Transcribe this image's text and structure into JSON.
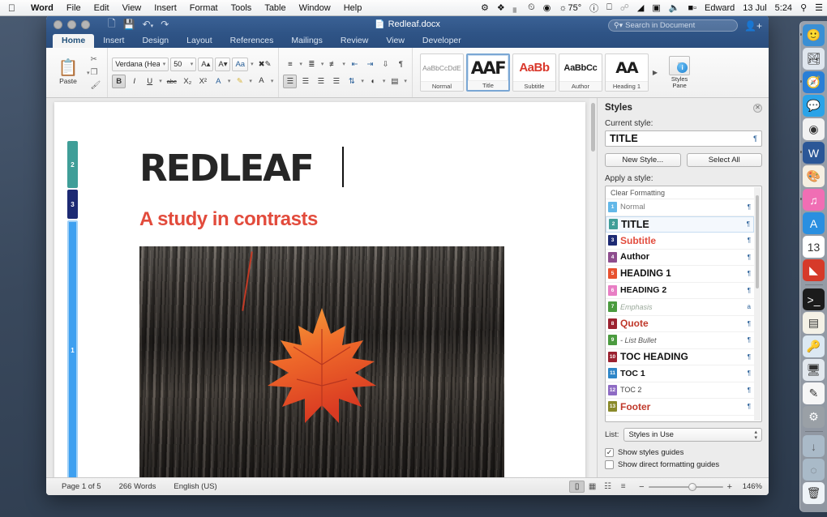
{
  "menubar": {
    "apple_icon": "apple-icon",
    "items": [
      {
        "label": "Word",
        "bold": true
      },
      {
        "label": "File",
        "bold": false
      },
      {
        "label": "Edit",
        "bold": false
      },
      {
        "label": "View",
        "bold": false
      },
      {
        "label": "Insert",
        "bold": false
      },
      {
        "label": "Format",
        "bold": false
      },
      {
        "label": "Tools",
        "bold": false
      },
      {
        "label": "Table",
        "bold": false
      },
      {
        "label": "Window",
        "bold": false
      },
      {
        "label": "Help",
        "bold": false
      }
    ],
    "status_icons": [
      "gear-icon",
      "dropbox-icon",
      "equalizer-icon",
      "clock-icon",
      "camera-icon"
    ],
    "brightness": "75°",
    "status_icons2": [
      "info-icon",
      "airplay-icon",
      "bluetooth-icon",
      "wifi-icon",
      "keyboard-icon",
      "volume-icon",
      "battery-icon"
    ],
    "user": "Edward",
    "date": "13 Jul",
    "time": "5:24",
    "search_icon": "search-icon",
    "notifications_icon": "notification-center-icon"
  },
  "titlebar": {
    "doc_icon": "word-document-icon",
    "title": "Redleaf.docx",
    "quick_access": [
      "new-document-icon",
      "save-icon",
      "undo-icon",
      "redo-icon"
    ]
  },
  "ribbon": {
    "tabs": [
      {
        "label": "Home",
        "active": true
      },
      {
        "label": "Insert",
        "active": false
      },
      {
        "label": "Design",
        "active": false
      },
      {
        "label": "Layout",
        "active": false
      },
      {
        "label": "References",
        "active": false
      },
      {
        "label": "Mailings",
        "active": false
      },
      {
        "label": "Review",
        "active": false
      },
      {
        "label": "View",
        "active": false
      },
      {
        "label": "Developer",
        "active": false
      }
    ],
    "search_placeholder": "Search in Document",
    "clipboard": {
      "paste_label": "Paste",
      "paste_icon": "clipboard-icon",
      "cut_icon": "scissors-icon",
      "copy_icon": "copy-icon",
      "format_painter_icon": "format-painter-icon"
    },
    "font": {
      "name": "Verdana (Hea....",
      "size": "50",
      "grow_label": "A",
      "shrink_label": "A",
      "change_case_label": "Aa",
      "clear_formatting_icon": "clear-formatting-icon",
      "bold_label": "B",
      "italic_label": "I",
      "underline_label": "U",
      "strikethrough_label": "abc",
      "subscript_label": "X₂",
      "superscript_label": "X²",
      "text_effects_label": "A",
      "highlight_label": "ab",
      "font_color_label": "A"
    },
    "paragraph": {
      "bullets_icon": "bulleted-list-icon",
      "numbering_icon": "numbered-list-icon",
      "multilevel_icon": "multilevel-list-icon",
      "decrease_indent_icon": "decrease-indent-icon",
      "increase_indent_icon": "increase-indent-icon",
      "sort_icon": "sort-icon",
      "show_marks_icon": "pilcrow-icon",
      "align_left_icon": "align-left-icon",
      "align_center_icon": "align-center-icon",
      "align_right_icon": "align-right-icon",
      "justify_icon": "justify-icon",
      "line_spacing_icon": "line-spacing-icon",
      "shading_icon": "shading-icon",
      "borders_icon": "borders-icon"
    },
    "styles_gallery": [
      {
        "preview": "AaBbCcDdE",
        "name": "Normal",
        "selected": false,
        "cls": "pv-normal"
      },
      {
        "preview": "AAF",
        "name": "Title",
        "selected": true,
        "cls": "pv-title"
      },
      {
        "preview": "AaBb",
        "name": "Subtitle",
        "selected": false,
        "cls": "pv-sub"
      },
      {
        "preview": "AaBbCc",
        "name": "Author",
        "selected": false,
        "cls": "pv-auth"
      },
      {
        "preview": "AA",
        "name": "Heading 1",
        "selected": false,
        "cls": "pv-h1"
      }
    ],
    "styles_pane_button": {
      "line1": "Styles",
      "line2": "Pane",
      "icon": "styles-pane-icon"
    }
  },
  "document": {
    "title": "REDLEAF",
    "subtitle": "A study in contrasts",
    "image_alt": "red maple leaf on charred wood",
    "guides": [
      {
        "num": "2",
        "style": "TITLE"
      },
      {
        "num": "3",
        "style": "Subtitle"
      },
      {
        "num": "1",
        "style": "Normal"
      }
    ]
  },
  "pane": {
    "title": "Styles",
    "close_icon": "close-icon",
    "current_style_label": "Current style:",
    "current_style": "TITLE",
    "new_style_button": "New Style...",
    "select_all_button": "Select All",
    "apply_label": "Apply a style:",
    "clear_formatting": "Clear Formatting",
    "styles": [
      {
        "num": "1",
        "name": "Normal",
        "badge": "#63b8e8",
        "color": "#7a7a7a",
        "size": "9.5px",
        "weight": "normal",
        "italic": false,
        "mark": "¶"
      },
      {
        "num": "2",
        "name": "TITLE",
        "badge": "#3f9e98",
        "color": "#111111",
        "size": "12.5px",
        "weight": "bold",
        "italic": false,
        "mark": "¶",
        "selected": true
      },
      {
        "num": "3",
        "name": "Subtitle",
        "badge": "#1d2a73",
        "color": "#e24b3c",
        "size": "12px",
        "weight": "bold",
        "italic": false,
        "mark": "¶"
      },
      {
        "num": "4",
        "name": "Author",
        "badge": "#8e4d8e",
        "color": "#111111",
        "size": "11px",
        "weight": "bold",
        "italic": false,
        "mark": "¶"
      },
      {
        "num": "5",
        "name": "HEADING 1",
        "badge": "#e8512f",
        "color": "#111111",
        "size": "11.5px",
        "weight": "bold",
        "italic": false,
        "mark": "¶"
      },
      {
        "num": "6",
        "name": "HEADING 2",
        "badge": "#e87ec4",
        "color": "#111111",
        "size": "10.5px",
        "weight": "bold",
        "italic": false,
        "mark": "¶"
      },
      {
        "num": "7",
        "name": "Emphasis",
        "badge": "#4b9b3f",
        "color": "#9aa89a",
        "size": "9px",
        "weight": "normal",
        "italic": true,
        "mark": "a"
      },
      {
        "num": "8",
        "name": "Quote",
        "badge": "#9b2230",
        "color": "#c0392b",
        "size": "12px",
        "weight": "bold",
        "italic": false,
        "mark": "¶"
      },
      {
        "num": "9",
        "name": "- List Bullet",
        "badge": "#4b9b3f",
        "color": "#555555",
        "size": "9px",
        "weight": "normal",
        "italic": true,
        "mark": "¶"
      },
      {
        "num": "10",
        "name": "TOC HEADING",
        "badge": "#9b2230",
        "color": "#111111",
        "size": "12px",
        "weight": "bold",
        "italic": false,
        "mark": "¶"
      },
      {
        "num": "11",
        "name": "TOC 1",
        "badge": "#2e86c8",
        "color": "#111111",
        "size": "10.5px",
        "weight": "bold",
        "italic": false,
        "mark": "¶"
      },
      {
        "num": "12",
        "name": "TOC 2",
        "badge": "#8e6bc4",
        "color": "#444444",
        "size": "9px",
        "weight": "normal",
        "italic": false,
        "mark": "¶"
      },
      {
        "num": "13",
        "name": "Footer",
        "badge": "#8a8a2a",
        "color": "#c0392b",
        "size": "12px",
        "weight": "bold",
        "italic": false,
        "mark": "¶"
      }
    ],
    "list_label": "List:",
    "list_value": "Styles in Use",
    "show_styles_guides": {
      "label": "Show styles guides",
      "checked": true
    },
    "show_direct_formatting": {
      "label": "Show direct formatting guides",
      "checked": false
    }
  },
  "status": {
    "page": "Page 1 of 5",
    "words": "266 Words",
    "language": "English (US)",
    "views": [
      {
        "icon": "print-layout-icon",
        "glyph": "▢",
        "active": true
      },
      {
        "icon": "web-layout-icon",
        "glyph": "▤",
        "active": false
      },
      {
        "icon": "outline-icon",
        "glyph": "☰",
        "active": false
      },
      {
        "icon": "draft-icon",
        "glyph": "≡",
        "active": false
      }
    ],
    "zoom_out": "−",
    "zoom_in": "+",
    "zoom_value": "146%"
  },
  "dock": {
    "items": [
      {
        "name": "finder",
        "glyph": "🙂",
        "bg": "#3a8fd4",
        "running": true
      },
      {
        "name": "preview",
        "glyph": "🏞",
        "bg": "#dfe6ee",
        "running": false
      },
      {
        "name": "safari",
        "glyph": "🧭",
        "bg": "#2a7fd6",
        "running": true
      },
      {
        "name": "messages",
        "glyph": "💬",
        "bg": "#2aa3e8",
        "running": false
      },
      {
        "name": "chrome",
        "glyph": "◉",
        "bg": "#f2f2f2",
        "running": false
      },
      {
        "name": "word",
        "glyph": "W",
        "bg": "#2b5797",
        "running": true
      },
      {
        "name": "sketch",
        "glyph": "🎨",
        "bg": "#f5efe2",
        "running": false
      },
      {
        "name": "itunes",
        "glyph": "♫",
        "bg": "#f06eb4",
        "running": true
      },
      {
        "name": "app-store",
        "glyph": "A",
        "bg": "#2a8fe0",
        "running": false
      },
      {
        "name": "calendar",
        "glyph": "13",
        "bg": "#ffffff",
        "running": false
      },
      {
        "name": "acrobat",
        "glyph": "◣",
        "bg": "#d63a2a",
        "running": false
      },
      {
        "name": "terminal",
        "glyph": ">_",
        "bg": "#1b1b1b",
        "running": false
      },
      {
        "name": "notes",
        "glyph": "▤",
        "bg": "#f4f1e6",
        "running": false
      },
      {
        "name": "keychain",
        "glyph": "🔑",
        "bg": "#dce8f2",
        "running": false
      },
      {
        "name": "screen-sharing",
        "glyph": "🖥",
        "bg": "#e2e8ee",
        "running": false
      },
      {
        "name": "markup",
        "glyph": "✎",
        "bg": "#f6f6f6",
        "running": false
      },
      {
        "name": "system-preferences",
        "glyph": "⚙",
        "bg": "#9aa0a6",
        "running": false
      },
      {
        "name": "downloads",
        "glyph": "↓",
        "bg": "#bfd6e8",
        "running": false
      },
      {
        "name": "documents",
        "glyph": "◌",
        "bg": "#bfd6e8",
        "running": false
      },
      {
        "name": "trash",
        "glyph": "🗑",
        "bg": "#eef3f7",
        "running": false
      }
    ]
  }
}
